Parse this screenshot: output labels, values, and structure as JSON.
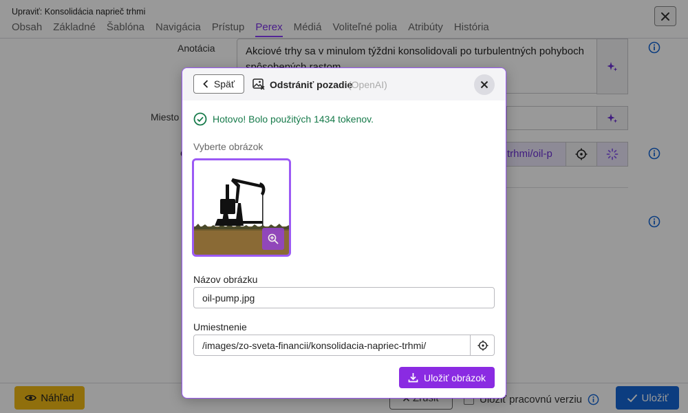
{
  "window": {
    "title": "Upraviť: Konsolidácia naprieč trhmi",
    "tabs": [
      "Obsah",
      "Základné",
      "Šablóna",
      "Navigácia",
      "Prístup",
      "Perex",
      "Médiá",
      "Voliteľné polia",
      "Atribúty",
      "História"
    ],
    "active_tab": "Perex"
  },
  "form": {
    "annotation_label": "Anotácia",
    "annotation_text": "Akciové trhy sa v minulom týždni konsolidovali po turbulentných pohyboch spôsobených rastom",
    "place_label": "Miesto",
    "image_label_partial": "O",
    "image_path_fragment": "trhmi/oil-p"
  },
  "footer": {
    "preview_label": "Náhľad",
    "cancel_label": "Zrušiť",
    "work_version_label": "Uložiť pracovnú verziu",
    "save_label": "Uložiť"
  },
  "modal": {
    "back_label": "Späť",
    "title": "Odstrániť pozadie",
    "provider": "(OpenAI)",
    "success_message": "Hotovo! Bolo použitých 1434 tokenov.",
    "select_image_label": "Vyberte obrázok",
    "image_name_label": "Názov obrázku",
    "image_name_value": "oil-pump.jpg",
    "location_label": "Umiestnenie",
    "location_value": "/images/zo-sveta-financii/konsolidacia-napriec-trhmi/",
    "save_image_label": "Uložiť obrázok"
  },
  "colors": {
    "accent": "#8a2be2",
    "success": "#167a4a",
    "primary": "#1567d6",
    "preview": "#f0ba14"
  }
}
